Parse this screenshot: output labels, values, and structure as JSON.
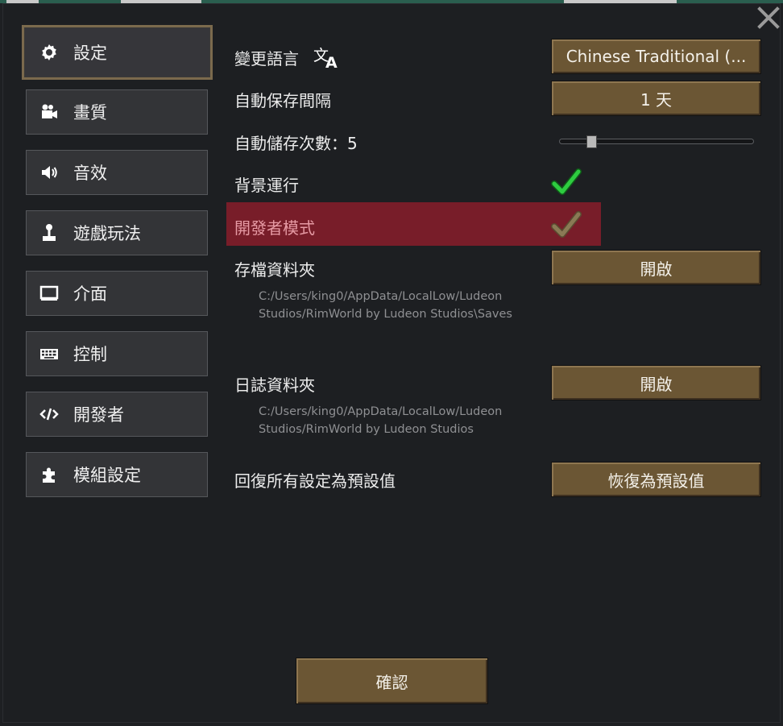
{
  "sidebar": {
    "items": [
      {
        "label": "設定",
        "icon": "gear-icon"
      },
      {
        "label": "畫質",
        "icon": "camera-icon"
      },
      {
        "label": "音效",
        "icon": "speaker-icon"
      },
      {
        "label": "遊戲玩法",
        "icon": "joystick-icon"
      },
      {
        "label": "介面",
        "icon": "monitor-icon"
      },
      {
        "label": "控制",
        "icon": "keyboard-icon"
      },
      {
        "label": "開發者",
        "icon": "code-icon"
      },
      {
        "label": "模組設定",
        "icon": "puzzle-icon"
      }
    ]
  },
  "settings": {
    "language": {
      "label": "變更語言",
      "value": "Chinese Traditional (...",
      "icon": "translate-icon"
    },
    "autosave_interval": {
      "label": "自動保存間隔",
      "value": "1 天"
    },
    "autosave_count": {
      "label": "自動儲存次數：5",
      "slider_fraction": 0.15
    },
    "run_in_background": {
      "label": "背景運行",
      "checked": true
    },
    "dev_mode": {
      "label": "開發者模式",
      "checked": true,
      "highlight_color": "#781d29"
    },
    "save_folder": {
      "label": "存檔資料夾",
      "button": "開啟",
      "path_line1": "C:/Users/king0/AppData/LocalLow/Ludeon",
      "path_line2": "Studios/RimWorld by Ludeon Studios\\Saves"
    },
    "log_folder": {
      "label": "日誌資料夾",
      "button": "開啟",
      "path_line1": "C:/Users/king0/AppData/LocalLow/Ludeon",
      "path_line2": "Studios/RimWorld by Ludeon Studios"
    },
    "reset": {
      "label": "回復所有設定為預設值",
      "button": "恢復為預設值"
    }
  },
  "footer": {
    "confirm_label": "確認"
  },
  "colors": {
    "button": "#6b5634",
    "active_tab_border": "#7b6a4d",
    "check_on": "#2ecc40",
    "check_dim": "#8a7a55",
    "background": "#1d1f22"
  }
}
